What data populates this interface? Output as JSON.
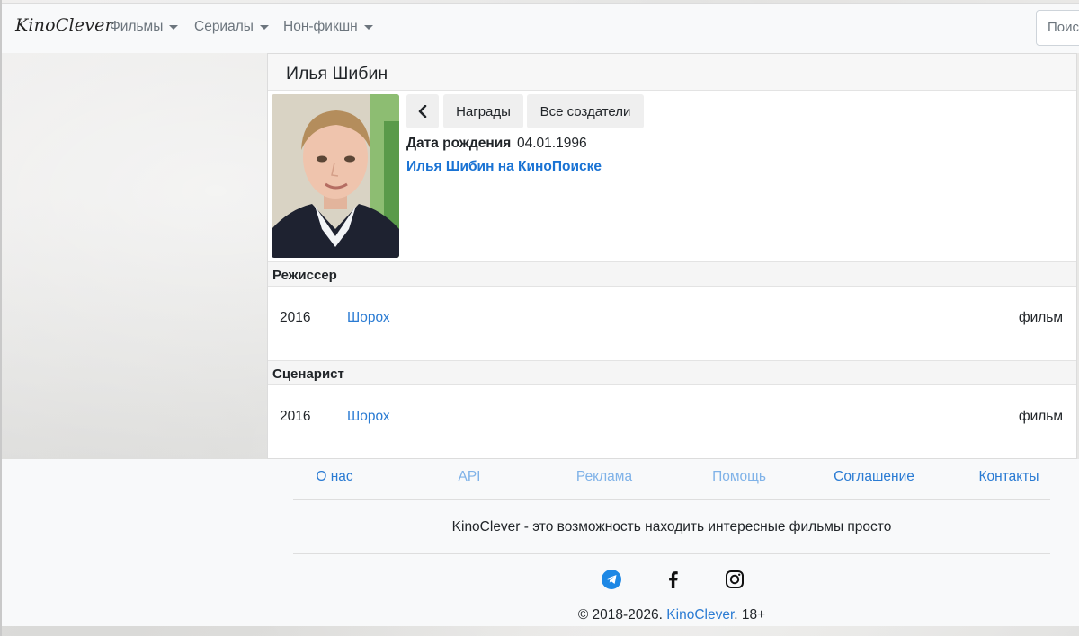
{
  "navbar": {
    "brand": "KinoClever",
    "items": [
      {
        "label": "Фильмы"
      },
      {
        "label": "Сериалы"
      },
      {
        "label": "Нон-фикшн"
      }
    ],
    "search_placeholder": "Поиск"
  },
  "person": {
    "name": "Илья Шибин",
    "buttons": {
      "awards": "Награды",
      "all_creators": "Все создатели"
    },
    "birth_label": "Дата рождения",
    "birth_value": "04.01.1996",
    "kinopoisk_link": "Илья Шибин на КиноПоиске"
  },
  "sections": [
    {
      "title": "Режиссер",
      "films": [
        {
          "year": "2016",
          "title": "Шорох",
          "type": "фильм"
        }
      ]
    },
    {
      "title": "Сценарист",
      "films": [
        {
          "year": "2016",
          "title": "Шорох",
          "type": "фильм"
        }
      ]
    }
  ],
  "footer": {
    "links": [
      "О нас",
      "API",
      "Реклама",
      "Помощь",
      "Соглашение",
      "Контакты"
    ],
    "tagline": "KinoClever - это возможность находить интересные фильмы просто",
    "social_icons": [
      "telegram-icon",
      "facebook-icon",
      "instagram-icon"
    ],
    "copyright_prefix": "© 2018-2026.",
    "copyright_brand": "KinoClever",
    "copyright_suffix": ". 18+"
  },
  "colors": {
    "link": "#2a7bd3",
    "link_light": "#7fb2e8",
    "telegram": "#1e88e5"
  }
}
